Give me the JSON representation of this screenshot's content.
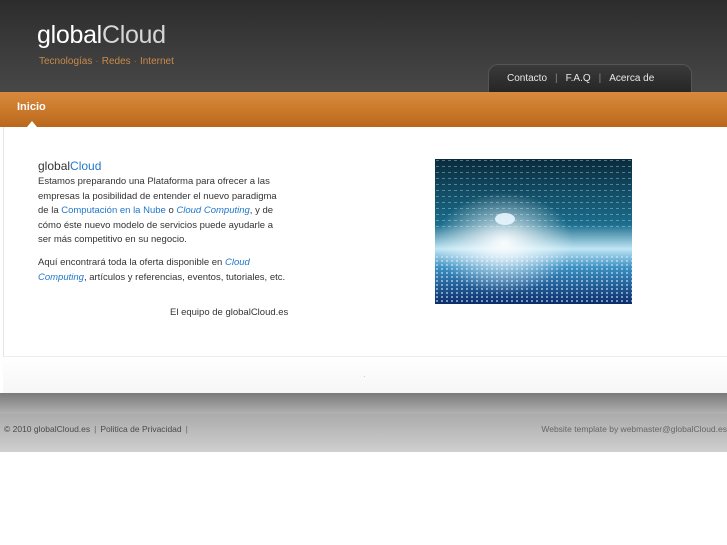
{
  "logo": {
    "part1": "global",
    "part2": "Cloud"
  },
  "tagline": [
    "Tecnologías",
    "Redes",
    "Internet"
  ],
  "topnav": [
    {
      "label": "Contacto"
    },
    {
      "label": "F.A.Q"
    },
    {
      "label": "Acerca de"
    }
  ],
  "nav": {
    "active": "Inicio"
  },
  "intro": {
    "title_part1": "global",
    "title_part2": "Cloud",
    "p1_a": "Estamos preparando una Plataforma para ofrecer a las empresas la posibilidad de entender el nuevo paradigma de la ",
    "p1_link1": "Computación en la Nube",
    "p1_b": " o ",
    "p1_link2": "Cloud Computing",
    "p1_c": ", y de cómo éste nuevo modelo de servicios puede ayudarle a ser más competitivo en  su negocio.",
    "p2_a": "Aquí encontrará toda la oferta disponible en ",
    "p2_link": "Cloud Computing",
    "p2_b": ", artículos y referencias, eventos, tutoriales, etc.",
    "signature": "El equipo de globalCloud.es"
  },
  "footer": {
    "copyright": "© 2010 globalCloud.es",
    "privacy": "Politica de Privacidad",
    "credit": "Website template by webmaster@globalCloud.es"
  },
  "colors": {
    "accent_orange": "#c87628",
    "link_blue": "#2277cc",
    "header_dark": "#333333"
  }
}
